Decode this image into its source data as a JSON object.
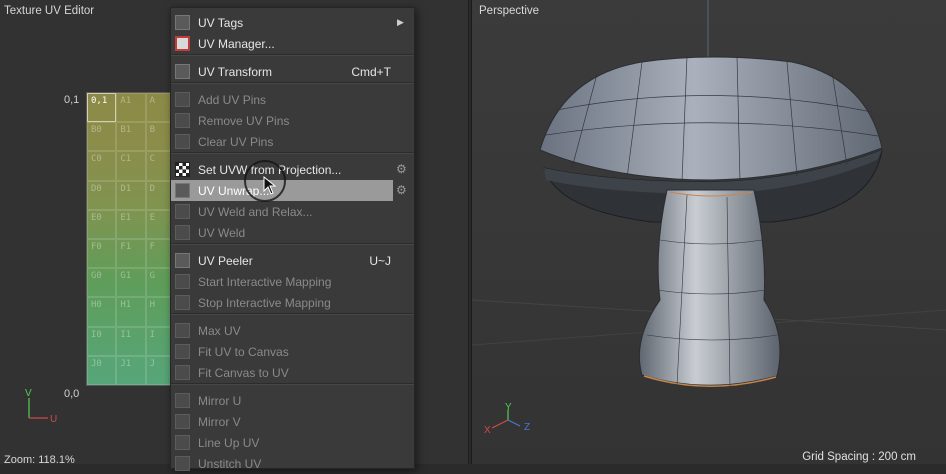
{
  "uv_editor": {
    "title": "Texture UV Editor",
    "label_top": "0,1",
    "label_bottom": "0,0",
    "axis_v": "V",
    "axis_u": "U",
    "zoom": "Zoom: 118.1%",
    "cells": [
      "0,1",
      "A1",
      "A",
      "B0",
      "B1",
      "B",
      "C0",
      "C1",
      "C",
      "D0",
      "D1",
      "D",
      "E0",
      "E1",
      "E",
      "F0",
      "F1",
      "F",
      "G0",
      "G1",
      "G",
      "H0",
      "H1",
      "H",
      "I0",
      "I1",
      "I",
      "J0",
      "J1",
      "J"
    ]
  },
  "viewport": {
    "title": "Perspective",
    "grid_spacing": "Grid Spacing : 200 cm",
    "axis_x": "X",
    "axis_y": "Y",
    "axis_z": "Z"
  },
  "menu": {
    "items": [
      {
        "label": "UV Tags",
        "icon": "uv-tags-icon",
        "submenu": true
      },
      {
        "label": "UV Manager...",
        "icon": "uv-manager-icon"
      },
      {
        "label": "UV Transform",
        "icon": "uv-transform-icon",
        "shortcut": "Cmd+T"
      },
      {
        "label": "Add UV Pins",
        "icon": "add-pins-icon",
        "disabled": true
      },
      {
        "label": "Remove UV Pins",
        "icon": "remove-pins-icon",
        "disabled": true
      },
      {
        "label": "Clear UV Pins",
        "icon": "clear-pins-icon",
        "disabled": true
      },
      {
        "label": "Set UVW from Projection...",
        "icon": "projection-icon",
        "gear": true
      },
      {
        "label": "UV Unwrap...",
        "icon": "unwrap-icon",
        "gear": true,
        "highlighted": true
      },
      {
        "label": "UV Weld and Relax...",
        "icon": "weld-relax-icon",
        "disabled": true
      },
      {
        "label": "UV Weld",
        "icon": "weld-icon",
        "disabled": true
      },
      {
        "label": "UV Peeler",
        "icon": "peeler-icon",
        "shortcut": "U~J"
      },
      {
        "label": "Start Interactive Mapping",
        "icon": "start-mapping-icon",
        "disabled": true
      },
      {
        "label": "Stop Interactive Mapping",
        "icon": "stop-mapping-icon",
        "disabled": true
      },
      {
        "label": "Max UV",
        "icon": "max-uv-icon",
        "disabled": true
      },
      {
        "label": "Fit UV to Canvas",
        "icon": "fit-canvas-icon",
        "disabled": true
      },
      {
        "label": "Fit Canvas to UV",
        "icon": "fit-uv-icon",
        "disabled": true
      },
      {
        "label": "Mirror U",
        "icon": "mirror-u-icon",
        "disabled": true
      },
      {
        "label": "Mirror V",
        "icon": "mirror-v-icon",
        "disabled": true
      },
      {
        "label": "Line Up UV",
        "icon": "line-up-icon",
        "disabled": true
      },
      {
        "label": "Unstitch UV",
        "icon": "unstitch-icon",
        "disabled": true
      }
    ]
  }
}
